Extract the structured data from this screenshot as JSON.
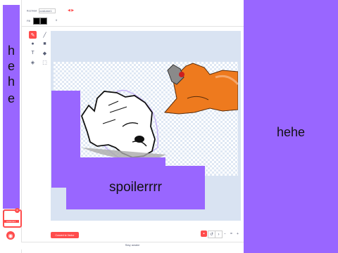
{
  "toolbar": {
    "costume_label": "Костюм",
    "costume_name": "costume1",
    "fill_label": "Fill",
    "outline_size": "0"
  },
  "tools": [
    "brush",
    "line",
    "circle",
    "rectangle",
    "text",
    "fill",
    "eraser",
    "select"
  ],
  "overlays": {
    "left_letters": [
      "h",
      "e",
      "h",
      "e"
    ],
    "center_text": "spoilerrrr",
    "right_text": "hehe"
  },
  "costume_list": {
    "selected_index": "1",
    "selected_label": "costume1"
  },
  "bottom": {
    "convert_label": "Convert to Vector",
    "zoom_minus": "−",
    "zoom_equal": "=",
    "zoom_plus": "+"
  },
  "status": {
    "text": "Stay awake"
  },
  "colors": {
    "accent": "#ff4c4c",
    "purple": "#9966ff",
    "canvas_bg": "#d9e3f2",
    "orange_cat": "#ee7a1e",
    "grey_cat": "#8a8a8a"
  }
}
